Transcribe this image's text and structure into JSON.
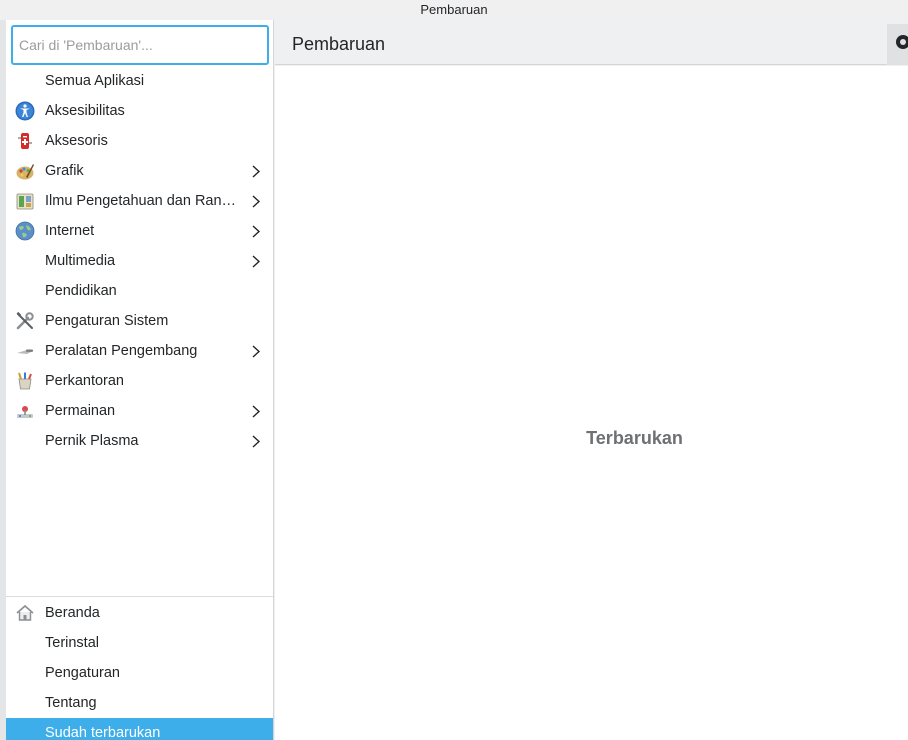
{
  "window": {
    "title": "Pembaruan"
  },
  "search": {
    "placeholder": "Cari di 'Pembaruan'..."
  },
  "categories": [
    {
      "label": "Semua Aplikasi",
      "icon": "none",
      "has_submenu": false
    },
    {
      "label": "Aksesibilitas",
      "icon": "accessibility-icon",
      "has_submenu": false
    },
    {
      "label": "Aksesoris",
      "icon": "accessories-icon",
      "has_submenu": false
    },
    {
      "label": "Grafik",
      "icon": "graphics-icon",
      "has_submenu": true
    },
    {
      "label": "Ilmu Pengetahuan dan Ran…",
      "icon": "science-icon",
      "has_submenu": true
    },
    {
      "label": "Internet",
      "icon": "internet-globe-icon",
      "has_submenu": true
    },
    {
      "label": "Multimedia",
      "icon": "none",
      "has_submenu": true
    },
    {
      "label": "Pendidikan",
      "icon": "none",
      "has_submenu": false
    },
    {
      "label": "Pengaturan Sistem",
      "icon": "system-settings-icon",
      "has_submenu": false
    },
    {
      "label": "Peralatan Pengembang",
      "icon": "developer-tools-icon",
      "has_submenu": true
    },
    {
      "label": "Perkantoran",
      "icon": "office-icon",
      "has_submenu": false
    },
    {
      "label": "Permainan",
      "icon": "games-icon",
      "has_submenu": true
    },
    {
      "label": "Pernik Plasma",
      "icon": "none",
      "has_submenu": true
    }
  ],
  "nav": [
    {
      "label": "Beranda",
      "icon": "home-icon",
      "active": false
    },
    {
      "label": "Terinstal",
      "icon": "none",
      "active": false
    },
    {
      "label": "Pengaturan",
      "icon": "none",
      "active": false
    },
    {
      "label": "Tentang",
      "icon": "none",
      "active": false
    },
    {
      "label": "Sudah terbarukan",
      "icon": "none",
      "active": true
    }
  ],
  "header": {
    "title": "Pembaruan"
  },
  "main": {
    "empty_message": "Terbarukan"
  },
  "colors": {
    "accent": "#3daee9",
    "background": "#eff0f1",
    "text": "#232629"
  }
}
